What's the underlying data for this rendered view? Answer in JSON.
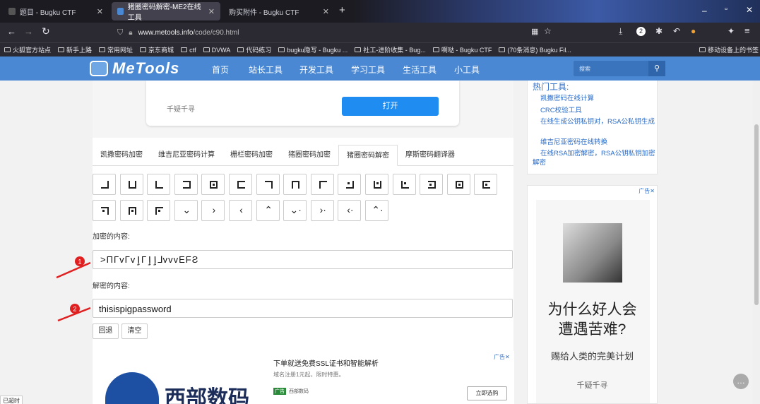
{
  "browser": {
    "tabs": [
      {
        "title": "题目 - Bugku CTF"
      },
      {
        "title": "猪圈密码解密-ME2在线工具"
      },
      {
        "title": "购买附件 - Bugku CTF"
      }
    ],
    "new_tab": "+",
    "url_host": "www.metools.info",
    "url_path": "/code/c90.html",
    "bookmarks": [
      "火狐官方站点",
      "新手上路",
      "常用网址",
      "京东商城",
      "ctf",
      "DVWA",
      "代码练习",
      "bugku隐写 - Bugku ...",
      "社工-进阶收集 - Bug...",
      "啊哒 - Bugku CTF",
      "(70条消息) Bugku Fil...",
      "移动设备上的书签"
    ]
  },
  "site": {
    "logo": "MeTools",
    "nav": [
      "首页",
      "站长工具",
      "开发工具",
      "学习工具",
      "生活工具",
      "小工具"
    ],
    "search_placeholder": "搜索"
  },
  "top_card": {
    "label": "千疑千寻",
    "button": "打开"
  },
  "tool_tabs": [
    "凯撒密码加密",
    "维吉尼亚密码计算",
    "栅栏密码加密",
    "猪圈密码加密",
    "猪圈密码解密",
    "摩斯密码翻译器"
  ],
  "active_tab": 4,
  "encrypt_label": "加密的内容:",
  "encrypt_value": ">ΠΓvΓvٳΓٳٳ⅃vvvEFƧ",
  "decrypt_label": "解密的内容:",
  "decrypt_value": "thisispigpassword",
  "buttons": {
    "back": "回退",
    "clear": "清空"
  },
  "annotations": [
    "1",
    "2"
  ],
  "sidebar": {
    "hot_title": "热门工具:",
    "links": [
      "凯撒密码在线计算",
      "CRC校验工具",
      "在线生成公钥私钥对，RSA公私钥生成",
      "维吉尼亚密码在线转换",
      "在线RSA加密解密，RSA公钥私钥加密解密"
    ]
  },
  "ad_right": {
    "tag": "广告✕",
    "headline": "为什么好人会遭遇苦难?",
    "sub": "赐给人类的完美计划",
    "caption": "千疑千寻"
  },
  "ad_bottom": {
    "tag": "广告✕",
    "title": "下单就送免费SSL证书和智能解析",
    "sub": "域名注册1元起，限时特惠。",
    "badge": "广告",
    "brand_small": "西部数码",
    "button": "立即选购",
    "brand_big": "西部数码"
  },
  "status_bar": "已超时"
}
